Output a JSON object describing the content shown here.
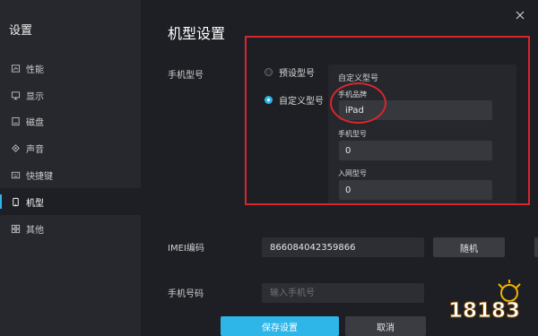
{
  "sidebar": {
    "title": "设置",
    "items": [
      {
        "label": "性能",
        "icon": "speed-icon"
      },
      {
        "label": "显示",
        "icon": "monitor-icon"
      },
      {
        "label": "磁盘",
        "icon": "disk-icon"
      },
      {
        "label": "声音",
        "icon": "speaker-icon"
      },
      {
        "label": "快捷键",
        "icon": "keyboard-icon"
      },
      {
        "label": "机型",
        "icon": "phone-icon",
        "active": true
      },
      {
        "label": "其他",
        "icon": "grid-icon"
      }
    ]
  },
  "main": {
    "title": "机型设置",
    "phone_model_label": "手机型号",
    "preset_option": "预设型号",
    "custom_option": "自定义型号",
    "selected_option": "自定义型号",
    "custom_panel": {
      "title": "自定义型号",
      "brand_label": "手机品牌",
      "brand_value": "iPad",
      "model_label": "手机型号",
      "model_value": "0",
      "network_label": "入网型号",
      "network_value": "0"
    },
    "imei_label": "IMEI编码",
    "imei_value": "866084042359866",
    "random_button": "随机",
    "phone_number_label": "手机号码",
    "phone_number_placeholder": "输入手机号",
    "save_button": "保存设置",
    "cancel_button": "取消"
  },
  "watermark": {
    "text": "18183"
  },
  "colors": {
    "accent": "#2fb6e8",
    "annotation_red": "#d8262d",
    "background": "#1d1f24",
    "sidebar": "#26282d"
  }
}
